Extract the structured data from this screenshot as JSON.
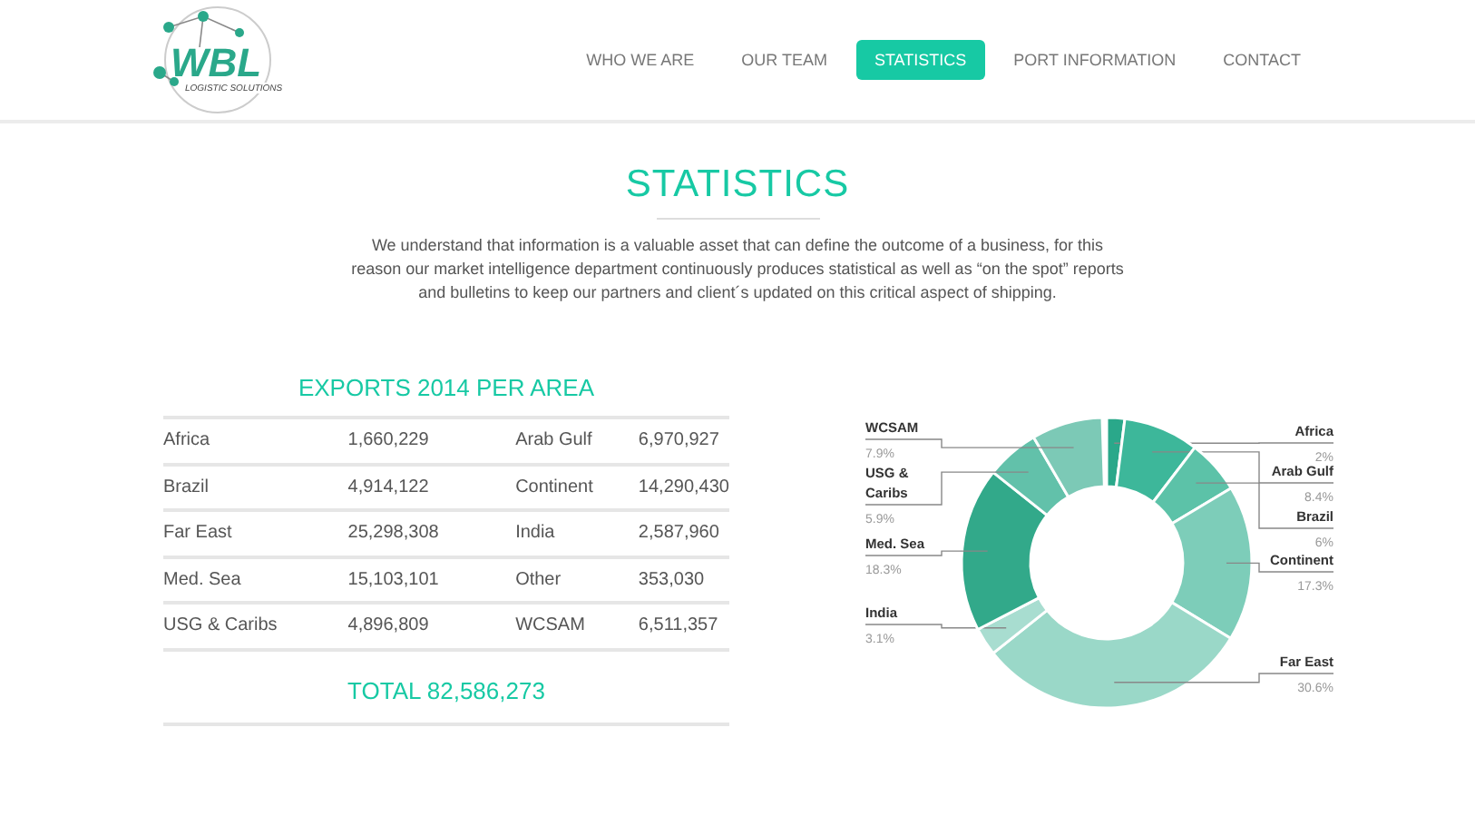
{
  "logo": {
    "name": "WBL",
    "tagline": "LOGISTIC SOLUTIONS"
  },
  "nav": [
    {
      "label": "WHO WE ARE",
      "selected": false
    },
    {
      "label": "OUR TEAM",
      "selected": false
    },
    {
      "label": "STATISTICS",
      "selected": true
    },
    {
      "label": "PORT INFORMATION",
      "selected": false
    },
    {
      "label": "CONTACT",
      "selected": false
    }
  ],
  "page_title": "STATISTICS",
  "intro": "We understand that information is a valuable asset that can define the outcome of a business, for this reason our market intelligence department continuously produces statistical as well as “on the spot” reports and bulletins to keep our partners and client´s updated on this critical aspect of shipping.",
  "exports": {
    "title": "EXPORTS 2014 PER AREA",
    "rows": [
      [
        "Africa",
        "1,660,229",
        "Arab Gulf",
        "6,970,927"
      ],
      [
        "Brazil",
        "4,914,122",
        "Continent",
        "14,290,430"
      ],
      [
        "Far East",
        "25,298,308",
        "India",
        "2,587,960"
      ],
      [
        "Med. Sea",
        "15,103,101",
        "Other",
        "353,030"
      ],
      [
        "USG & Caribs",
        "4,896,809",
        "WCSAM",
        "6,511,357"
      ]
    ],
    "total": "TOTAL 82,586,273"
  },
  "chart_data": {
    "type": "donut",
    "categories": [
      "Africa",
      "Arab Gulf",
      "Brazil",
      "Continent",
      "Far East",
      "India",
      "Med. Sea",
      "USG & Caribs",
      "WCSAM"
    ],
    "values": [
      2,
      8.4,
      6,
      17.3,
      30.6,
      3.1,
      18.3,
      5.9,
      7.9
    ],
    "colors": [
      "#2aa88a",
      "#3db79a",
      "#5cc2a8",
      "#7dcdb9",
      "#9ad8c8",
      "#a8ddd0",
      "#32a98a",
      "#62c1aa",
      "#7cc9b6"
    ],
    "value_labels": [
      "2%",
      "8.4%",
      "6%",
      "17.3%",
      "30.6%",
      "3.1%",
      "18.3%",
      "5.9%",
      "7.9%"
    ]
  }
}
